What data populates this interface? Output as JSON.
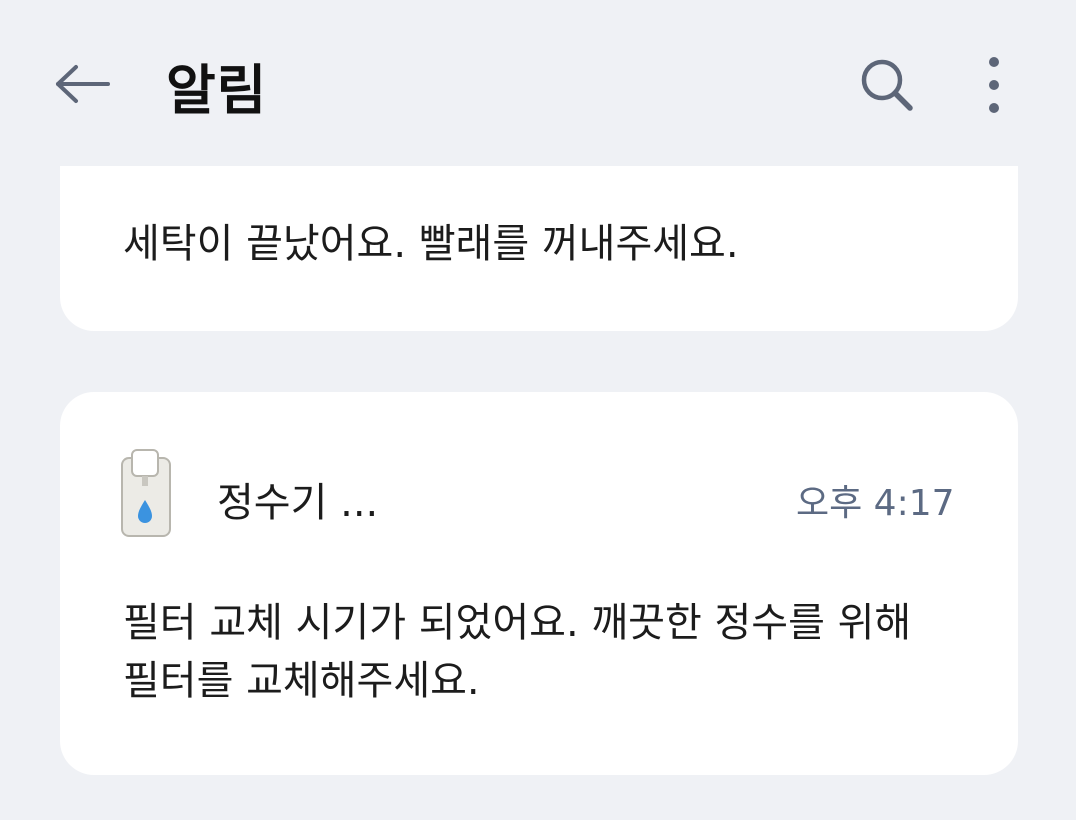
{
  "header": {
    "title": "알림",
    "back_icon": "arrow-left-icon",
    "search_icon": "search-icon",
    "more_icon": "more-vertical-icon"
  },
  "notifications": [
    {
      "message": "세탁이 끝났어요. 빨래를 꺼내주세요."
    },
    {
      "app_icon": "water-purifier-icon",
      "app_name": "정수기 ...",
      "time": "오후 4:17",
      "message": "필터 교체 시기가 되었어요. 깨끗한 정수를 위해 필터를 교체해주세요."
    }
  ],
  "colors": {
    "background": "#eff1f5",
    "card": "#ffffff",
    "timestamp": "#5c6a83",
    "icon": "#5d6678"
  }
}
